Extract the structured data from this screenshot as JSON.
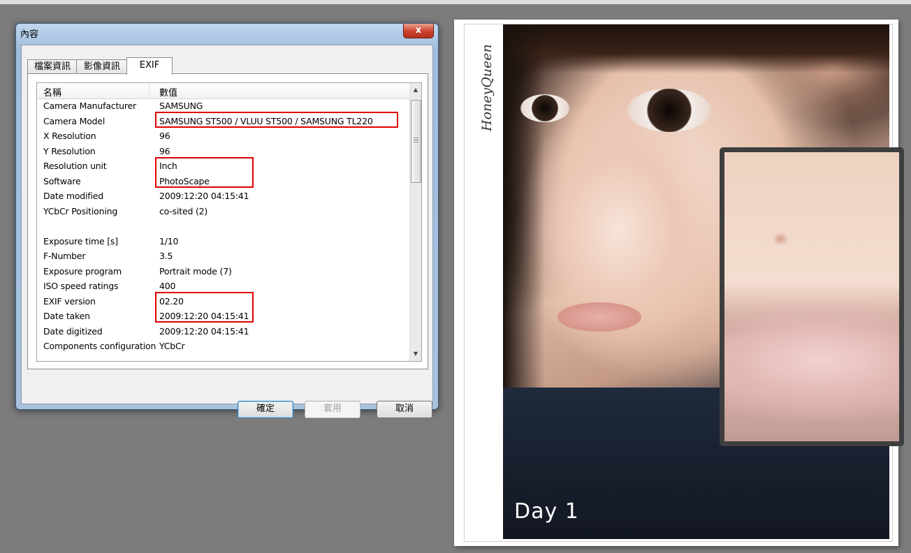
{
  "dialog": {
    "title": "內容",
    "close_label": "x",
    "tabs": [
      {
        "label": "檔案資訊"
      },
      {
        "label": "影像資訊"
      },
      {
        "label": "EXIF"
      }
    ],
    "columns": {
      "name": "名稱",
      "value": "數值"
    },
    "rows": [
      {
        "name": "Camera Manufacturer",
        "value": "SAMSUNG"
      },
      {
        "name": "Camera Model",
        "value": "SAMSUNG ST500 / VLUU ST500 / SAMSUNG TL220"
      },
      {
        "name": "X Resolution",
        "value": "96"
      },
      {
        "name": "Y Resolution",
        "value": "96"
      },
      {
        "name": "Resolution unit",
        "value": "Inch"
      },
      {
        "name": "Software",
        "value": "PhotoScape"
      },
      {
        "name": "Date modified",
        "value": "2009:12:20 04:15:41"
      },
      {
        "name": "YCbCr Positioning",
        "value": "co-sited (2)"
      },
      {
        "name": "",
        "value": ""
      },
      {
        "name": "Exposure time [s]",
        "value": "1/10"
      },
      {
        "name": "F-Number",
        "value": "3.5"
      },
      {
        "name": "Exposure program",
        "value": "Portrait mode (7)"
      },
      {
        "name": "ISO speed ratings",
        "value": "400"
      },
      {
        "name": "EXIF version",
        "value": "02.20"
      },
      {
        "name": "Date taken",
        "value": "2009:12:20 04:15:41"
      },
      {
        "name": "Date digitized",
        "value": "2009:12:20 04:15:41"
      },
      {
        "name": "Components configuration",
        "value": "YCbCr"
      }
    ],
    "buttons": {
      "ok": "確定",
      "apply": "套用",
      "cancel": "取消"
    }
  },
  "photo": {
    "signature": "HoneyQueen",
    "caption": "Day 1"
  },
  "colors": {
    "highlight": "#e00000",
    "desktop": "#7c7c7c"
  }
}
